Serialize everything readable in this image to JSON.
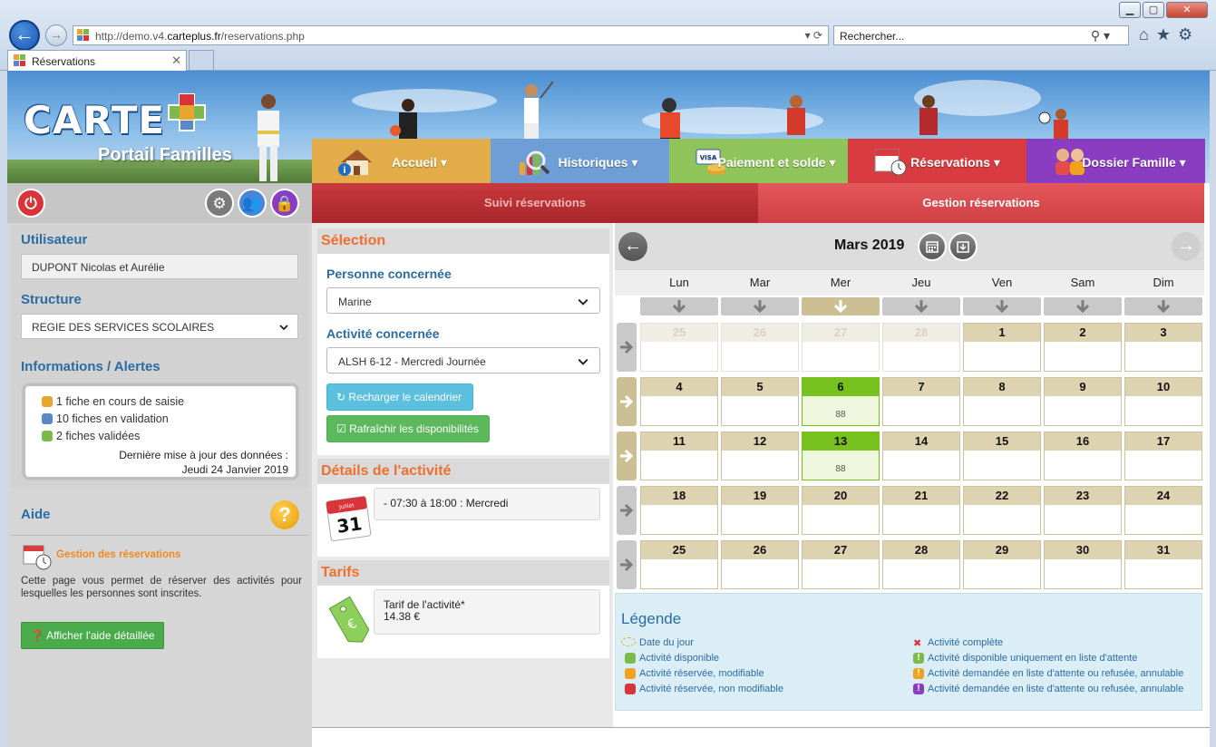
{
  "browser": {
    "url_prefix": "http://demo.v4.",
    "url_domain": "carteplus.fr",
    "url_path": "/reservations.php",
    "search_placeholder": "Rechercher...",
    "tab_title": "Réservations"
  },
  "header": {
    "logo_text": "CARTE",
    "portal_title": "Portail Familles"
  },
  "main_nav": [
    {
      "label": "Accueil ▾",
      "color": "#e2ad48"
    },
    {
      "label": "Historiques ▾",
      "color": "#6f9ed6"
    },
    {
      "label": "Paiement et solde ▾",
      "color": "#8fc45a"
    },
    {
      "label": "Réservations ▾",
      "color": "#d83c40"
    },
    {
      "label": "Dossier Famille ▾",
      "color": "#8b3dc2"
    }
  ],
  "sub_nav": {
    "suivi": "Suivi réservations",
    "gestion": "Gestion réservations"
  },
  "sidebar": {
    "utilisateur_label": "Utilisateur",
    "utilisateur_value": "DUPONT Nicolas et Aurélie",
    "structure_label": "Structure",
    "structure_value": "REGIE DES SERVICES SCOLAIRES",
    "alerts_label": "Informations / Alertes",
    "alerts": [
      {
        "text": "1 fiche en cours de saisie",
        "color": "#e8a631"
      },
      {
        "text": "10 fiches en validation",
        "color": "#5b87c6"
      },
      {
        "text": "2 fiches validées",
        "color": "#7cba4b"
      }
    ],
    "alerts_update_label": "Dernière mise à jour des données :",
    "alerts_update_date": "Jeudi 24 Janvier 2019",
    "aide_label": "Aide",
    "aide_title": "Gestion des réservations",
    "aide_text": "Cette page vous permet de réserver des activités pour lesquelles les personnes sont inscrites.",
    "aide_button": "Afficher l'aide détaillée"
  },
  "selection": {
    "title": "Sélection",
    "personne_label": "Personne concernée",
    "personne_value": "Marine",
    "activite_label": "Activité concernée",
    "activite_value": "ALSH 6-12 - Mercredi Journée",
    "btn_recharger": "Recharger le calendrier",
    "btn_rafraichir": "Rafraîchir les disponibilités"
  },
  "details": {
    "title": "Détails de l'activité",
    "text": "- 07:30 à 18:00 : Mercredi",
    "calendar_icon_month": "Juillet",
    "calendar_icon_day": "31"
  },
  "tarifs": {
    "title": "Tarifs",
    "label": "Tarif de l'activité*",
    "value": "14.38 €"
  },
  "calendar": {
    "title": "Mars 2019",
    "weekdays": [
      "Lun",
      "Mar",
      "Mer",
      "Jeu",
      "Ven",
      "Sam",
      "Dim"
    ],
    "active_column": 2,
    "active_rows": [
      1,
      2
    ],
    "weeks": [
      [
        {
          "d": "25",
          "s": "other"
        },
        {
          "d": "26",
          "s": "other"
        },
        {
          "d": "27",
          "s": "other"
        },
        {
          "d": "28",
          "s": "other"
        },
        {
          "d": "1",
          "s": ""
        },
        {
          "d": "2",
          "s": ""
        },
        {
          "d": "3",
          "s": ""
        }
      ],
      [
        {
          "d": "4",
          "s": ""
        },
        {
          "d": "5",
          "s": ""
        },
        {
          "d": "6",
          "s": "green",
          "sub": "88"
        },
        {
          "d": "7",
          "s": ""
        },
        {
          "d": "8",
          "s": ""
        },
        {
          "d": "9",
          "s": ""
        },
        {
          "d": "10",
          "s": ""
        }
      ],
      [
        {
          "d": "11",
          "s": ""
        },
        {
          "d": "12",
          "s": ""
        },
        {
          "d": "13",
          "s": "green",
          "sub": "88"
        },
        {
          "d": "14",
          "s": ""
        },
        {
          "d": "15",
          "s": ""
        },
        {
          "d": "16",
          "s": ""
        },
        {
          "d": "17",
          "s": ""
        }
      ],
      [
        {
          "d": "18",
          "s": ""
        },
        {
          "d": "19",
          "s": ""
        },
        {
          "d": "20",
          "s": ""
        },
        {
          "d": "21",
          "s": ""
        },
        {
          "d": "22",
          "s": ""
        },
        {
          "d": "23",
          "s": ""
        },
        {
          "d": "24",
          "s": ""
        }
      ],
      [
        {
          "d": "25",
          "s": ""
        },
        {
          "d": "26",
          "s": ""
        },
        {
          "d": "27",
          "s": ""
        },
        {
          "d": "28",
          "s": ""
        },
        {
          "d": "29",
          "s": ""
        },
        {
          "d": "30",
          "s": ""
        },
        {
          "d": "31",
          "s": ""
        }
      ]
    ]
  },
  "legend": {
    "title": "Légende",
    "items_left": [
      {
        "text": "Date du jour",
        "mark": "today",
        "color": "#e8a631"
      },
      {
        "text": "Activité disponible",
        "mark": "box",
        "color": "#7cba4b"
      },
      {
        "text": "Activité réservée, modifiable",
        "mark": "box",
        "color": "#f0a11d"
      },
      {
        "text": "Activité réservée, non modifiable",
        "mark": "box",
        "color": "#d8343a"
      }
    ],
    "items_right": [
      {
        "text": "Activité complète",
        "mark": "cross",
        "color": "#d8343a"
      },
      {
        "text": "Activité disponible uniquement en liste d'attente",
        "mark": "excl",
        "color": "#7cba4b"
      },
      {
        "text": "Activité demandée en liste d'attente ou refusée, annulable",
        "mark": "excl",
        "color": "#f0a11d"
      },
      {
        "text": "Activité demandée en liste d'attente ou refusée, annulable",
        "mark": "excl",
        "color": "#8b3dc2"
      }
    ]
  }
}
